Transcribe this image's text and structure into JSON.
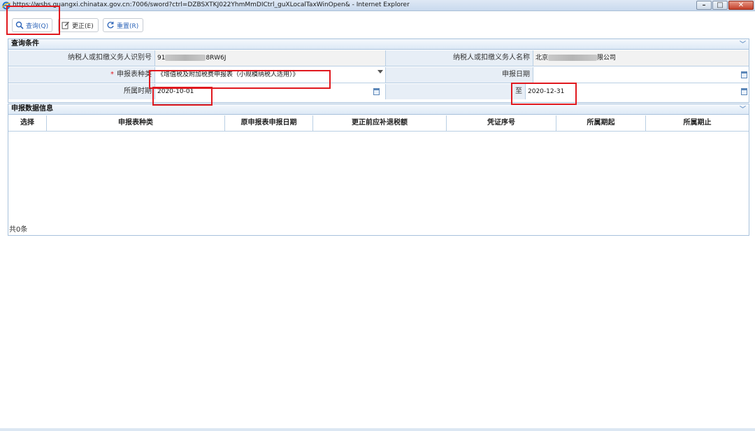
{
  "window": {
    "title": "https://wsbs.guangxi.chinatax.gov.cn:7006/sword?ctrl=DZBSXTKJ022YhmMmDICtrl_guXLocalTaxWinOpen& - Internet Explorer",
    "browser_icon": "ie-icon",
    "controls": [
      "minimize",
      "maximize",
      "close"
    ]
  },
  "toolbar": {
    "query": {
      "label": "查询(Q)",
      "icon": "search-icon"
    },
    "correct": {
      "label": "更正(E)",
      "icon": "edit-icon"
    },
    "reset": {
      "label": "重置(R)",
      "icon": "refresh-icon"
    }
  },
  "query_section": {
    "title": "查询条件",
    "taxpayer_id_label": "纳税人或扣缴义务人识别号",
    "taxpayer_id_prefix": "91",
    "taxpayer_id_suffix": "8RW6J",
    "taxpayer_name_label": "纳税人或扣缴义务人名称",
    "taxpayer_name_prefix": "北京",
    "taxpayer_name_suffix": "限公司",
    "report_type_label": "申报表种类",
    "report_type_required": "*",
    "report_type_value": "《增值税及附加税费申报表（小规模纳税人适用）》",
    "report_date_label": "申报日期",
    "report_date_value": "",
    "period_label": "所属时期",
    "period_start": "2020-10-01",
    "period_to_label": "至",
    "period_end": "2020-12-31"
  },
  "data_section": {
    "title": "申报数据信息",
    "columns": [
      "选择",
      "申报表种类",
      "原申报表申报日期",
      "更正前应补退税额",
      "凭证序号",
      "所属期起",
      "所属期止"
    ],
    "rows": [],
    "total": "共0条"
  },
  "colors": {
    "highlight": "#e0191f",
    "header_bg": "#dde9f6",
    "label_bg": "#e7eef6",
    "border": "#b9cfe4",
    "link_blue": "#2c64b8"
  }
}
